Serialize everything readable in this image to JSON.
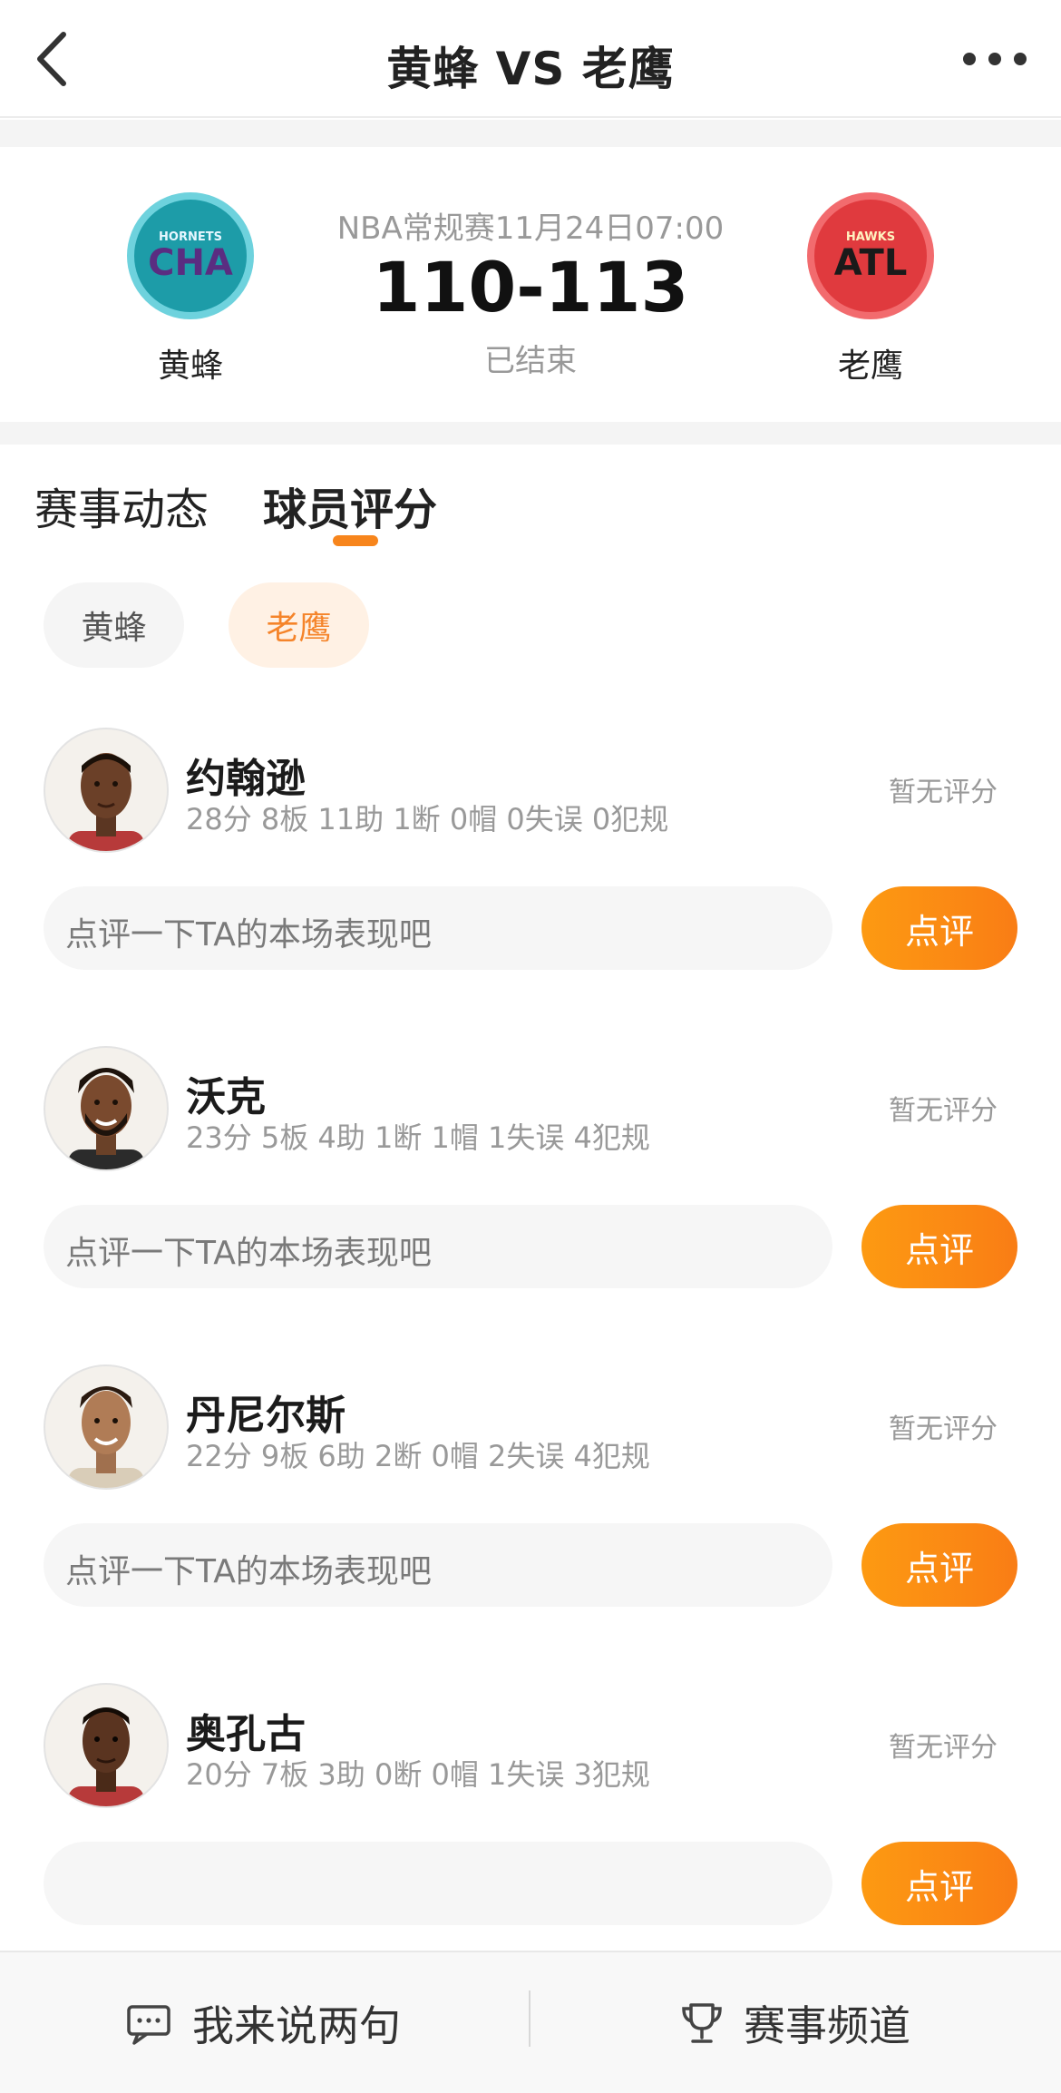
{
  "nav": {
    "title": "黄蜂 VS 老鹰"
  },
  "match": {
    "info": "NBA常规赛11月24日07:00",
    "score": "110-113",
    "status": "已结束",
    "home": {
      "name": "黄蜂",
      "logo_small": "HORNETS",
      "logo_big": "CHA"
    },
    "away": {
      "name": "老鹰",
      "logo_small": "HAWKS",
      "logo_big": "ATL"
    }
  },
  "tabs": [
    {
      "label": "赛事动态"
    },
    {
      "label": "球员评分"
    }
  ],
  "team_filter": [
    {
      "label": "黄蜂",
      "active": false
    },
    {
      "label": "老鹰",
      "active": true
    }
  ],
  "players": [
    {
      "name": "约翰逊",
      "stats": "28分 8板 11助 1断 0帽 0失误 0犯规",
      "rating": "暂无评分",
      "comment_placeholder": "点评一下TA的本场表现吧",
      "button": "点评"
    },
    {
      "name": "沃克",
      "stats": "23分 5板 4助 1断 1帽 1失误 4犯规",
      "rating": "暂无评分",
      "comment_placeholder": "点评一下TA的本场表现吧",
      "button": "点评"
    },
    {
      "name": "丹尼尔斯",
      "stats": "22分 9板 6助 2断 0帽 2失误 4犯规",
      "rating": "暂无评分",
      "comment_placeholder": "点评一下TA的本场表现吧",
      "button": "点评"
    },
    {
      "name": "奥孔古",
      "stats": "20分 7板 3助 0断 0帽 1失误 3犯规",
      "rating": "暂无评分",
      "comment_placeholder": "",
      "button": "点评"
    }
  ],
  "bottom_bar": {
    "left_label": "我来说两句",
    "right_label": "赛事频道"
  },
  "colors": {
    "accent": "#f7851c",
    "muted": "#999999"
  }
}
